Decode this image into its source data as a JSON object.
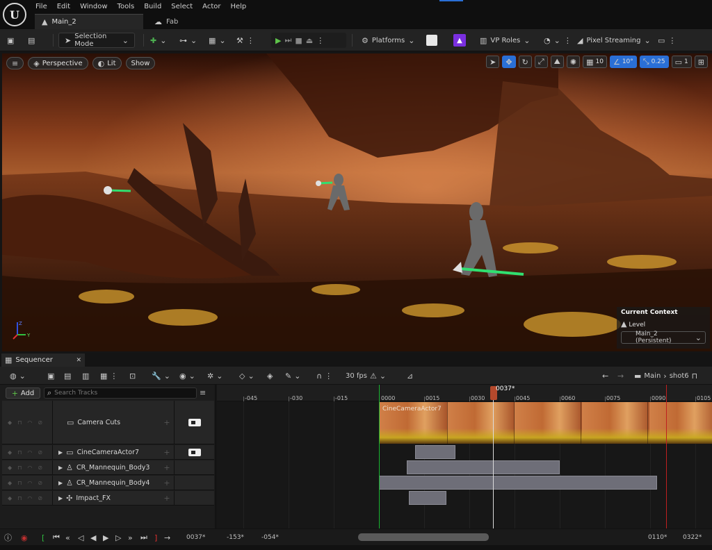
{
  "window": {
    "logo": "U",
    "menu": [
      "File",
      "Edit",
      "Window",
      "Tools",
      "Build",
      "Select",
      "Actor",
      "Help"
    ],
    "tabs": [
      {
        "label": "Main_2",
        "icon": "level-icon"
      },
      {
        "label": "Fab",
        "icon": "fab-icon"
      }
    ]
  },
  "toolbar": {
    "selection_mode": "Selection Mode",
    "platforms": "Platforms",
    "vp_roles": "VP Roles",
    "pixel_streaming": "Pixel Streaming"
  },
  "viewport": {
    "perspective": "Perspective",
    "lit": "Lit",
    "show": "Show",
    "grid_snap": "10",
    "rotation_snap": "10°",
    "scale_snap": "0.25",
    "camera_speed": "1",
    "context": {
      "title": "Current Context",
      "level_label": "Level",
      "level_value": "Main_2 (Persistent)"
    },
    "axis_labels": {
      "z": "Z",
      "y": "Y"
    }
  },
  "sequencer": {
    "tab_label": "Sequencer",
    "fps": "30 fps",
    "breadcrumb": [
      "Main",
      "shot6"
    ],
    "add_label": "Add",
    "search_placeholder": "Search Tracks",
    "tracks": [
      {
        "name": "Camera Cuts",
        "icon": "camera-cuts-icon"
      },
      {
        "name": "CineCameraActor7",
        "icon": "cine-camera-icon"
      },
      {
        "name": "CR_Mannequin_Body3",
        "icon": "skeletal-mesh-icon"
      },
      {
        "name": "CR_Mannequin_Body4",
        "icon": "skeletal-mesh-icon"
      },
      {
        "name": "Impact_FX",
        "icon": "particle-fx-icon"
      }
    ],
    "ruler_ticks": [
      "-045",
      "-030",
      "-015",
      "0000",
      "0015",
      "0030",
      "0045",
      "0060",
      "0075",
      "0090",
      "0105"
    ],
    "playhead": "0037*",
    "camera_clip_label": "CineCameraActor7",
    "transport": {
      "current_frame": "0037*",
      "view_start": "-153*",
      "view_end": "-054*",
      "play_end": "0110*",
      "view_max": "0322*"
    }
  }
}
